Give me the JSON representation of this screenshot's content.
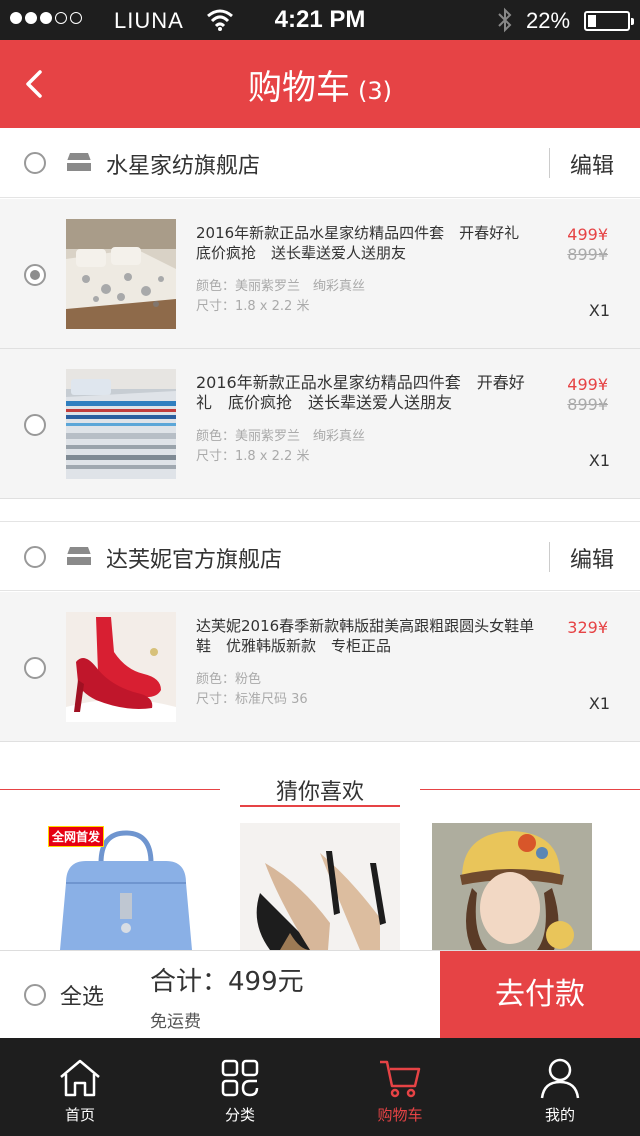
{
  "status_bar": {
    "carrier": "LIUNA",
    "time": "4:21 PM",
    "battery": "22%",
    "battery_level": 0.22
  },
  "header": {
    "title": "购物车",
    "count": "(3)",
    "back_icon": "chevron-left-icon"
  },
  "shops": [
    {
      "name": "水星家纺旗舰店",
      "edit_label": "编辑",
      "items": [
        {
          "title": "2016年新款正品水星家纺精品四件套　开春好礼　底价疯抢　送长辈送爱人送朋友",
          "color": "颜色：美丽紫罗兰　绚彩真丝",
          "size": "尺寸：1.8 x 2.2 米",
          "price": "499¥",
          "old_price": "899¥",
          "qty": "X1",
          "selected": true
        },
        {
          "title": "2016年新款正品水星家纺精品四件套　开春好礼　底价疯抢　送长辈送爱人送朋友",
          "color": "颜色：美丽紫罗兰　绚彩真丝",
          "size": "尺寸：1.8 x 2.2 米",
          "price": "499¥",
          "old_price": "899¥",
          "qty": "X1",
          "selected": false
        }
      ]
    },
    {
      "name": "达芙妮官方旗舰店",
      "edit_label": "编辑",
      "items": [
        {
          "title": "达芙妮2016春季新款韩版甜美高跟粗跟圆头女鞋单鞋　优雅韩版新款　专柜正品",
          "color": "颜色：粉色",
          "size": "尺寸：标准尺码 36",
          "price": "329¥",
          "qty": "X1",
          "selected": false
        }
      ]
    }
  ],
  "recommend": {
    "title": "猜你喜欢",
    "badge": "全网首发"
  },
  "checkout": {
    "select_all": "全选",
    "total": "合计：499元",
    "shipping": "免运费",
    "pay_label": "去付款"
  },
  "tabbar": [
    {
      "label": "首页",
      "icon": "home-icon"
    },
    {
      "label": "分类",
      "icon": "category-icon"
    },
    {
      "label": "购物车",
      "icon": "cart-icon",
      "active": true
    },
    {
      "label": "我的",
      "icon": "user-icon"
    }
  ],
  "colors": {
    "accent": "#e64345",
    "bar": "#1e1e1e"
  }
}
